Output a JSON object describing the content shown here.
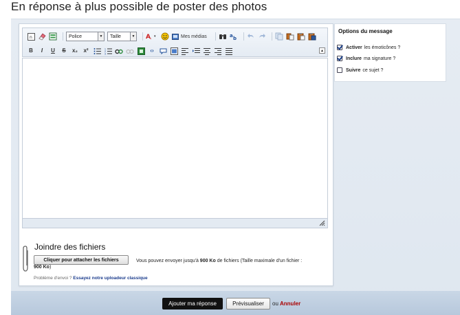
{
  "page": {
    "title": "En réponse à plus possible de poster des photos"
  },
  "toolbar": {
    "font_select": "Police",
    "size_select": "Taille",
    "media_label": "Mes médias",
    "row1_icons": [
      "html-source-icon",
      "eraser-icon",
      "template-icon"
    ],
    "row1_after_selects": [
      "font-color-icon",
      "smiley-icon",
      "media-icon"
    ],
    "row1_end": [
      "binoculars-icon",
      "replace-icon",
      "undo-icon",
      "redo-icon",
      "copy-icon",
      "cut-icon",
      "paste-icon",
      "paste-word-icon"
    ],
    "row2": [
      "B",
      "I",
      "U",
      "S",
      "x₂",
      "x²"
    ]
  },
  "options": {
    "title": "Options du message",
    "items": [
      {
        "bold": "Activer",
        "rest": "les émoticônes ?",
        "checked": true
      },
      {
        "bold": "Inclure",
        "rest": "ma signature ?",
        "checked": true
      },
      {
        "bold": "Suivre",
        "rest": "ce sujet ?",
        "checked": false
      }
    ]
  },
  "attach": {
    "title": "Joindre des fichiers",
    "button": "Cliquer pour attacher les fichiers",
    "info_prefix": "Vous pouvez envoyer jusqu'à",
    "info_size": "900 Ko",
    "info_suffix": "de fichiers (Taille maximale d'un fichier :",
    "info_size2": "900 Ko",
    "info_end": ")",
    "problem_text": "Problème d'envoi ?",
    "problem_link": "Essayez notre uploadeur classique"
  },
  "footer": {
    "submit": "Ajouter ma réponse",
    "preview": "Prévisualiser",
    "or": "ou",
    "cancel": "Annuler"
  },
  "colors": {
    "accent_dark": "#111111",
    "link": "#1a3b8c",
    "cancel": "#aa0000",
    "panel_bg": "#e1e8f1"
  }
}
